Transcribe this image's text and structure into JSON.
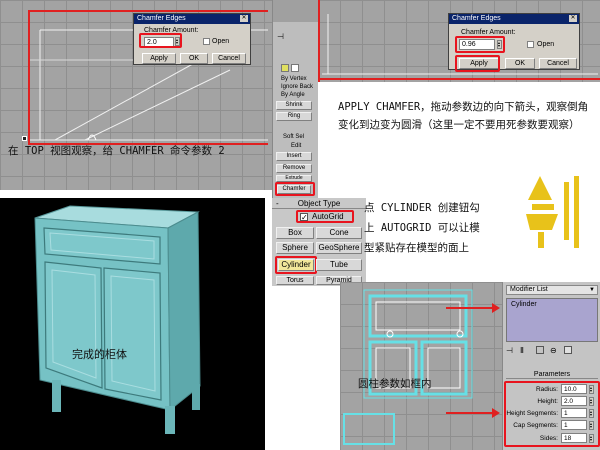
{
  "panel1": {
    "dialog_title": "Chamfer Edges",
    "amount_label": "Chamfer Amount:",
    "amount_value": "2.0",
    "open_label": "Open",
    "apply_label": "Apply",
    "ok_label": "OK",
    "cancel_label": "Cancel",
    "caption": "在 TOP 视图观察，给 CHAMFER 命令参数 2",
    "side_items": [
      "By Vertex",
      "Ignore Back",
      "By Angle",
      "Shrink",
      "Ring",
      "Soft Sel",
      "Edit",
      "Insert",
      "Remove",
      "Extrude"
    ],
    "chamfer_label": "Chamfer"
  },
  "panel2": {
    "dialog_title": "Chamfer Edges",
    "amount_label": "Chamfer Amount:",
    "amount_value": "0.96",
    "open_label": "Open",
    "apply_label": "Apply",
    "ok_label": "OK",
    "cancel_label": "Cancel",
    "caption": "APPLY CHAMFER，拖动参数边的向下箭头，观察倒角变化到边变为圆滑（这里一定不要用死参数要观察）"
  },
  "panel3": {
    "caption": "完成的柜体"
  },
  "panel4": {
    "header": "Object Type",
    "autogrid_label": "AutoGrid",
    "buttons": [
      "Box",
      "Cone",
      "Sphere",
      "GeoSphere",
      "Cylinder",
      "Tube",
      "Torus",
      "Pyramid"
    ],
    "caption": "点 CYLINDER 创建钮勾上 AUTOGRID 可以让模型紧贴存在模型的面上"
  },
  "panel5": {
    "modifier_list_label": "Modifier List",
    "stack_item": "Cylinder",
    "rollout_title": "Parameters",
    "params": [
      {
        "label": "Radius:",
        "value": "10.0"
      },
      {
        "label": "Height:",
        "value": "2.0"
      },
      {
        "label": "Height Segments:",
        "value": "1"
      },
      {
        "label": "Cap Segments:",
        "value": "1"
      },
      {
        "label": "Sides:",
        "value": "18"
      }
    ],
    "caption": "圆柱参数如框内"
  },
  "colors": {
    "highlight": "#e8141e",
    "dialog_title_bg": "#0a246a",
    "cabinet": "#7fc6c9",
    "logo": "#e8c21a"
  }
}
